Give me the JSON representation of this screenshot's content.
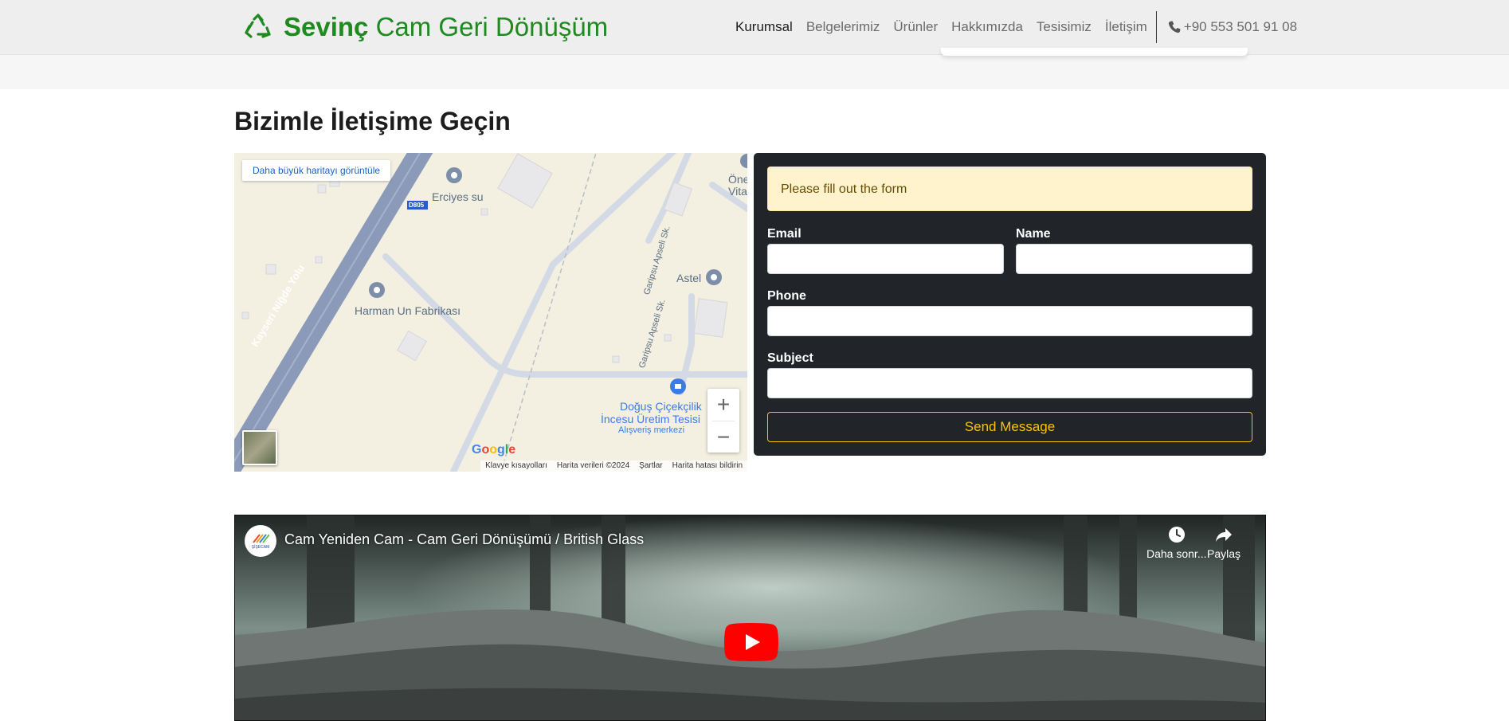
{
  "header": {
    "brand_bold": "Sevinç",
    "brand_rest": "Cam Geri Dönüşüm",
    "nav": [
      "Kurumsal",
      "Belgelerimiz",
      "Ürünler",
      "Hakkımızda",
      "Tesisimiz",
      "İletişim"
    ],
    "phone": "+90 553 501 91 08"
  },
  "contact": {
    "title": "Bizimle İletişime Geçin"
  },
  "map": {
    "larger_map_link": "Daha büyük haritayı görüntüle",
    "places": [
      "Erciyes su",
      "Harman Un Fabrikası",
      "Astel",
      "Doğuş Çiçekçilik",
      "İncesu Üretim Tesisi",
      "Alışveriş merkezi",
      "Öne",
      "Vita"
    ],
    "roads": [
      "Kayseri Niğde Yolu",
      "Garipsu Apseli Sk.",
      "Garipsu Apseli Sk.",
      "D805"
    ],
    "google": "Google",
    "attribution": [
      "Klavye kısayolları",
      "Harita verileri ©2024",
      "Şartlar",
      "Harita hatası bildirin"
    ],
    "zoom_in": "+",
    "zoom_out": "−"
  },
  "form": {
    "alert": "Please fill out the form",
    "email_label": "Email",
    "name_label": "Name",
    "phone_label": "Phone",
    "subject_label": "Subject",
    "email_value": "",
    "name_value": "",
    "phone_value": "",
    "subject_value": "",
    "submit": "Send Message"
  },
  "video": {
    "title": "Cam Yeniden Cam - Cam Geri Dönüşümü / British Glass",
    "channel": "ŞİŞECAM",
    "watch_later": "Daha sonr...",
    "share": "Paylaş"
  },
  "colors": {
    "brand_green": "#1f8a1f",
    "navbar_bg": "#efeeee",
    "card_bg": "#212529",
    "alert_bg": "#fff3cd",
    "button_yellow": "#ffc107",
    "youtube_red": "#ff0000"
  },
  "icons": [
    "recycle-icon",
    "phone-icon",
    "map-pin-icon",
    "clock-icon",
    "share-icon",
    "play-icon"
  ]
}
